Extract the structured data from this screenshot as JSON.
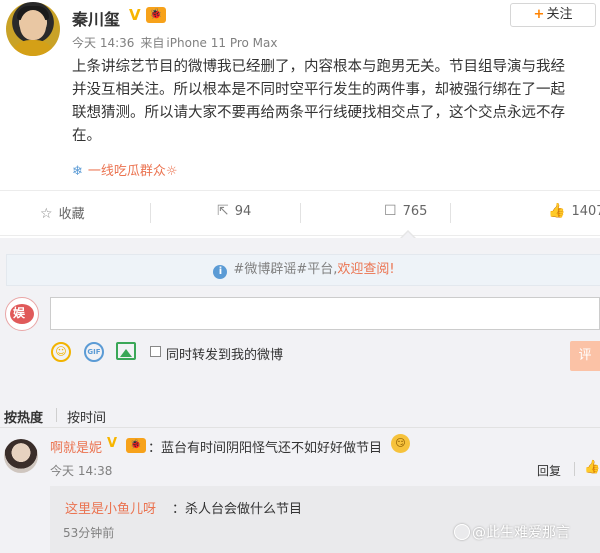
{
  "post": {
    "username": "秦川玺",
    "verified_mark": "V",
    "level_badge": "🐞",
    "follow_label": "关注",
    "follow_plus": "+",
    "time": "今天 14:36",
    "via_prefix": "来自",
    "device": "iPhone 11 Pro Max",
    "content_lines": [
      "上条讲综艺节目的微博我已经删了，内容根本与跑男无关。节目组导演与我经",
      "并没互相关注。所以根本是不同时空平行发生的两件事，却被强行绑在了一起",
      "联想猜测。所以请大家不要再给两条平行线硬找相交点了，这个交点永远不存",
      "在。"
    ],
    "source_icon": "❄",
    "source_text": "一线吃瓜群众☼"
  },
  "actions": {
    "favorite_label": "收藏",
    "repost_count": "94",
    "comment_count": "765",
    "like_count": "1407"
  },
  "notice": {
    "text_prefix": "#微博辟谣#平台,",
    "link": "欢迎查阅!"
  },
  "composer": {
    "avatar_text": "娱",
    "repost_label": "同时转发到我的微博",
    "submit_label": "评"
  },
  "sort": {
    "hot": "按热度",
    "time": "按时间"
  },
  "comment": {
    "user": "啊就是妮",
    "verified_mark": "V",
    "level_badge": "🐞",
    "text": "：蓝台有时间阴阳怪气还不如好好做节目",
    "emoji": "😏",
    "time": "今天 14:38",
    "reply_label": "回复",
    "reply": {
      "user": "这里是小鱼儿呀",
      "text": "：杀人台会做什么节目",
      "time": "53分钟前"
    }
  },
  "watermark": "@此生难爱那言"
}
